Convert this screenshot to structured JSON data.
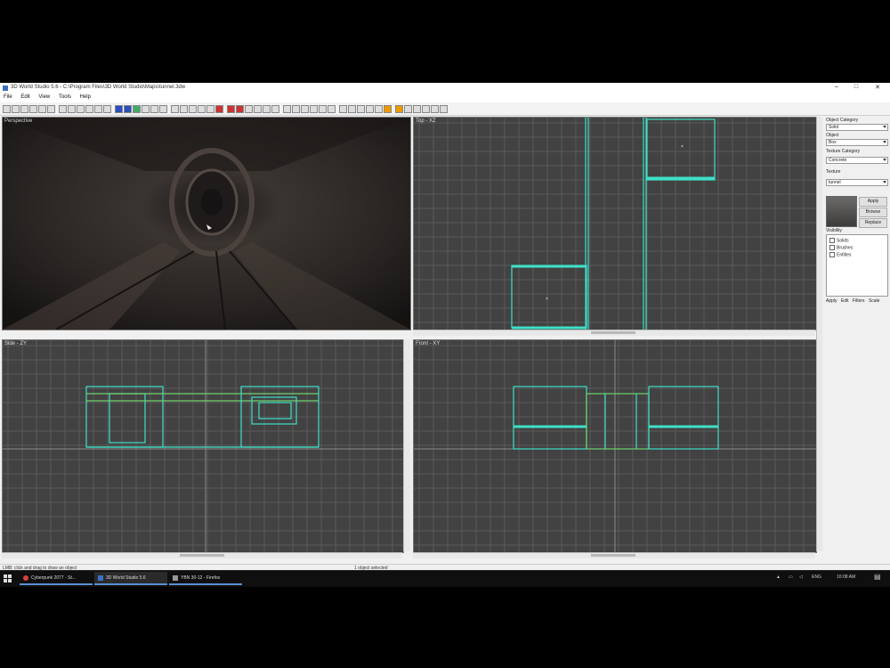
{
  "window": {
    "title": "3D World Studio 5.6 - C:\\Program Files\\3D World Studio\\Maps\\tunnel.3dw",
    "minimize": "–",
    "maximize": "□",
    "close": "✕"
  },
  "menu": [
    "File",
    "Edit",
    "View",
    "Tools",
    "Help"
  ],
  "viewports": {
    "perspective": {
      "label": "Perspective"
    },
    "top": {
      "label": "Top - XZ"
    },
    "side": {
      "label": "Side - ZY"
    },
    "front": {
      "label": "Front - XY"
    }
  },
  "panel": {
    "object_category_label": "Object Category",
    "object_category_value": "Solid",
    "object_label": "Object",
    "object_value": "Box",
    "texture_category_label": "Texture Category",
    "texture_category_value": "Concrete",
    "texture_label": "Texture",
    "texture_value": "tunnel",
    "apply_button": "Apply",
    "browse_button": "Browse",
    "replace_button": "Replace",
    "visibility_label": "Visibility",
    "visibility_items": [
      "Solids",
      "Brushes",
      "Entities"
    ],
    "tabs": [
      "Apply",
      "Edit",
      "Filters",
      "Scale"
    ]
  },
  "status": {
    "left": "LMB: click and drag to draw an object",
    "middle": "1 object selected"
  },
  "taskbar": {
    "items": [
      "Cyberpunk 2077 - St...",
      "3D World Studio 5.6",
      "YBN 30-12 - Firefox"
    ],
    "clock": "10:08 AM",
    "language": "ENG"
  },
  "colors": {
    "brush_outline": "#3ee0c8",
    "grid_bg": "#424242",
    "grid_line": "#5a5a5a",
    "axis_line": "#8a8a8a"
  },
  "icons": [
    "windows-start-icon",
    "firefox-icon",
    "folder-icon",
    "network-icon",
    "volume-icon",
    "notification-icon"
  ]
}
